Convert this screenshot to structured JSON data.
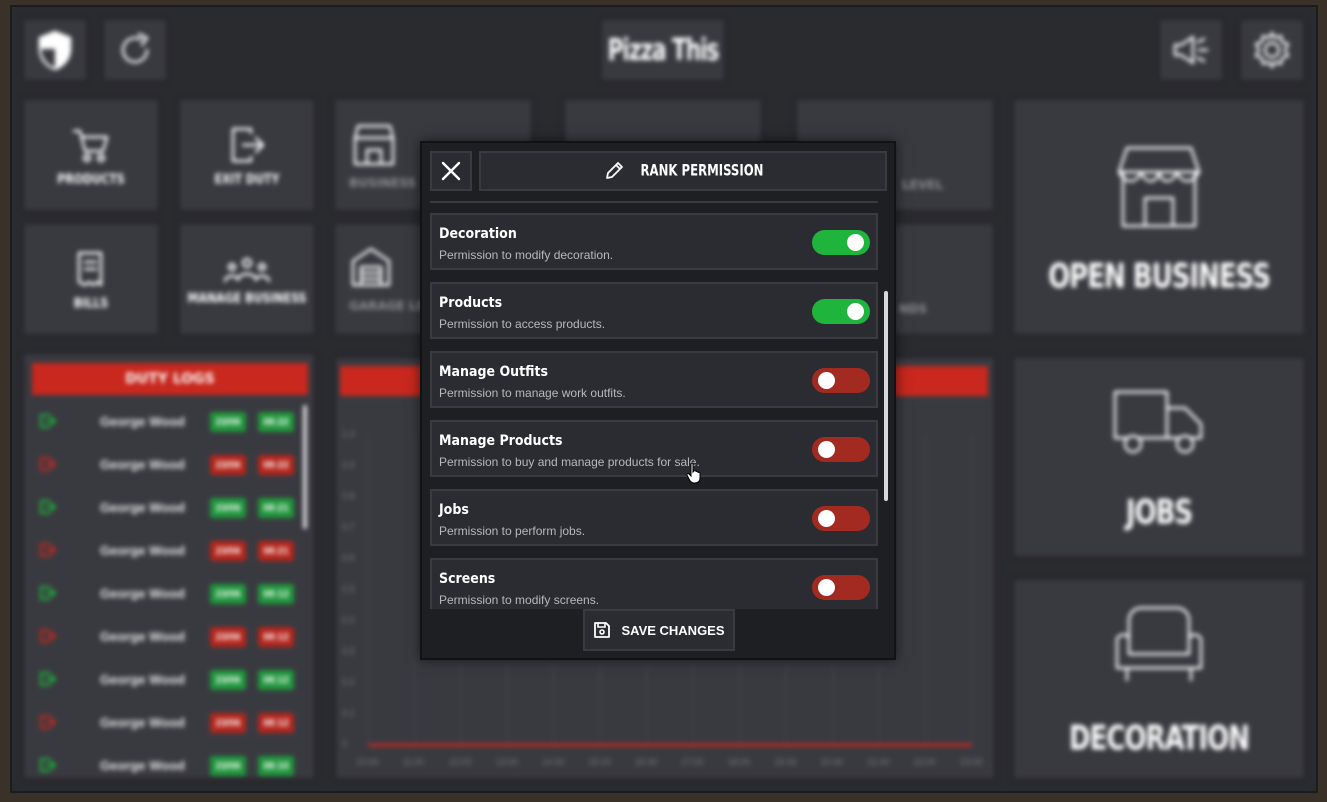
{
  "header": {
    "title": "Pizza This"
  },
  "tiles": {
    "products": "PRODUCTS",
    "exit_duty": "EXIT DUTY",
    "bills": "BILLS",
    "manage_business": "MANAGE BUSINESS",
    "business": "BUSINESS",
    "garage_level": "GARAGE LE",
    "level": "LEVEL",
    "funds": "NDS"
  },
  "big_buttons": {
    "open_business": "OPEN BUSINESS",
    "jobs": "JOBS",
    "decoration": "DECORATION"
  },
  "duty_logs": {
    "title": "DUTY LOGS",
    "rows": [
      {
        "name": "George Wood",
        "date": "23/06",
        "time": "08:22",
        "status": "in"
      },
      {
        "name": "George Wood",
        "date": "23/06",
        "time": "08:22",
        "status": "out"
      },
      {
        "name": "George Wood",
        "date": "23/06",
        "time": "08:21",
        "status": "in"
      },
      {
        "name": "George Wood",
        "date": "23/06",
        "time": "08:21",
        "status": "out"
      },
      {
        "name": "George Wood",
        "date": "23/06",
        "time": "08:12",
        "status": "in"
      },
      {
        "name": "George Wood",
        "date": "23/06",
        "time": "08:12",
        "status": "out"
      },
      {
        "name": "George Wood",
        "date": "23/06",
        "time": "08:12",
        "status": "in"
      },
      {
        "name": "George Wood",
        "date": "23/06",
        "time": "08:12",
        "status": "out"
      },
      {
        "name": "George Wood",
        "date": "23/06",
        "time": "08:10",
        "status": "in"
      }
    ]
  },
  "chart_data": {
    "type": "line",
    "y_ticks": [
      "1.0",
      "0.9",
      "0.8",
      "0.7",
      "0.6",
      "0.5",
      "0.4",
      "0.3",
      "0.2",
      "0.1",
      "0"
    ],
    "x_ticks": [
      "10:00",
      "11:00",
      "12:00",
      "13:00",
      "14:00",
      "15:00",
      "16:00",
      "17:00",
      "18:00",
      "19:00",
      "20:00",
      "21:00",
      "22:00",
      "23:00"
    ],
    "values": [
      0,
      0,
      0,
      0,
      0,
      0,
      0,
      0,
      0,
      0,
      0,
      0,
      0,
      0
    ],
    "ylim": [
      0,
      1
    ],
    "color": "#c8281e"
  },
  "modal": {
    "title": "RANK PERMISSION",
    "save_label": "SAVE CHANGES",
    "permissions": [
      {
        "title": "Decoration",
        "desc": "Permission to modify decoration.",
        "enabled": true
      },
      {
        "title": "Products",
        "desc": "Permission to access products.",
        "enabled": true
      },
      {
        "title": "Manage Outfits",
        "desc": "Permission to manage work outfits.",
        "enabled": false
      },
      {
        "title": "Manage Products",
        "desc": "Permission to buy and manage products for sale.",
        "enabled": false
      },
      {
        "title": "Jobs",
        "desc": "Permission to perform jobs.",
        "enabled": false
      },
      {
        "title": "Screens",
        "desc": "Permission to modify screens.",
        "enabled": false
      }
    ]
  },
  "colors": {
    "on": "#1fb43c",
    "off": "#a32a20",
    "accent": "#c8281e"
  }
}
